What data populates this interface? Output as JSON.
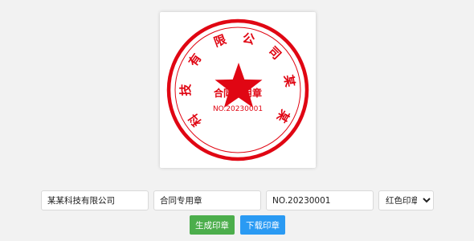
{
  "seal": {
    "color": "#e00613",
    "ring_chars": [
      "科",
      "技",
      "有",
      "限",
      "公",
      "司",
      "某",
      "某"
    ],
    "center_text": "合同专用章",
    "number_text": "NO.20230001",
    "star_icon": "star-icon"
  },
  "form": {
    "company_value": "某某科技有限公司",
    "type_value": "合同专用章",
    "number_value": "NO.20230001",
    "color_selected": "红色印章"
  },
  "buttons": {
    "generate_label": "生成印章",
    "generate_color": "#4cae4c",
    "download_label": "下载印章",
    "download_color": "#2a9af3"
  }
}
